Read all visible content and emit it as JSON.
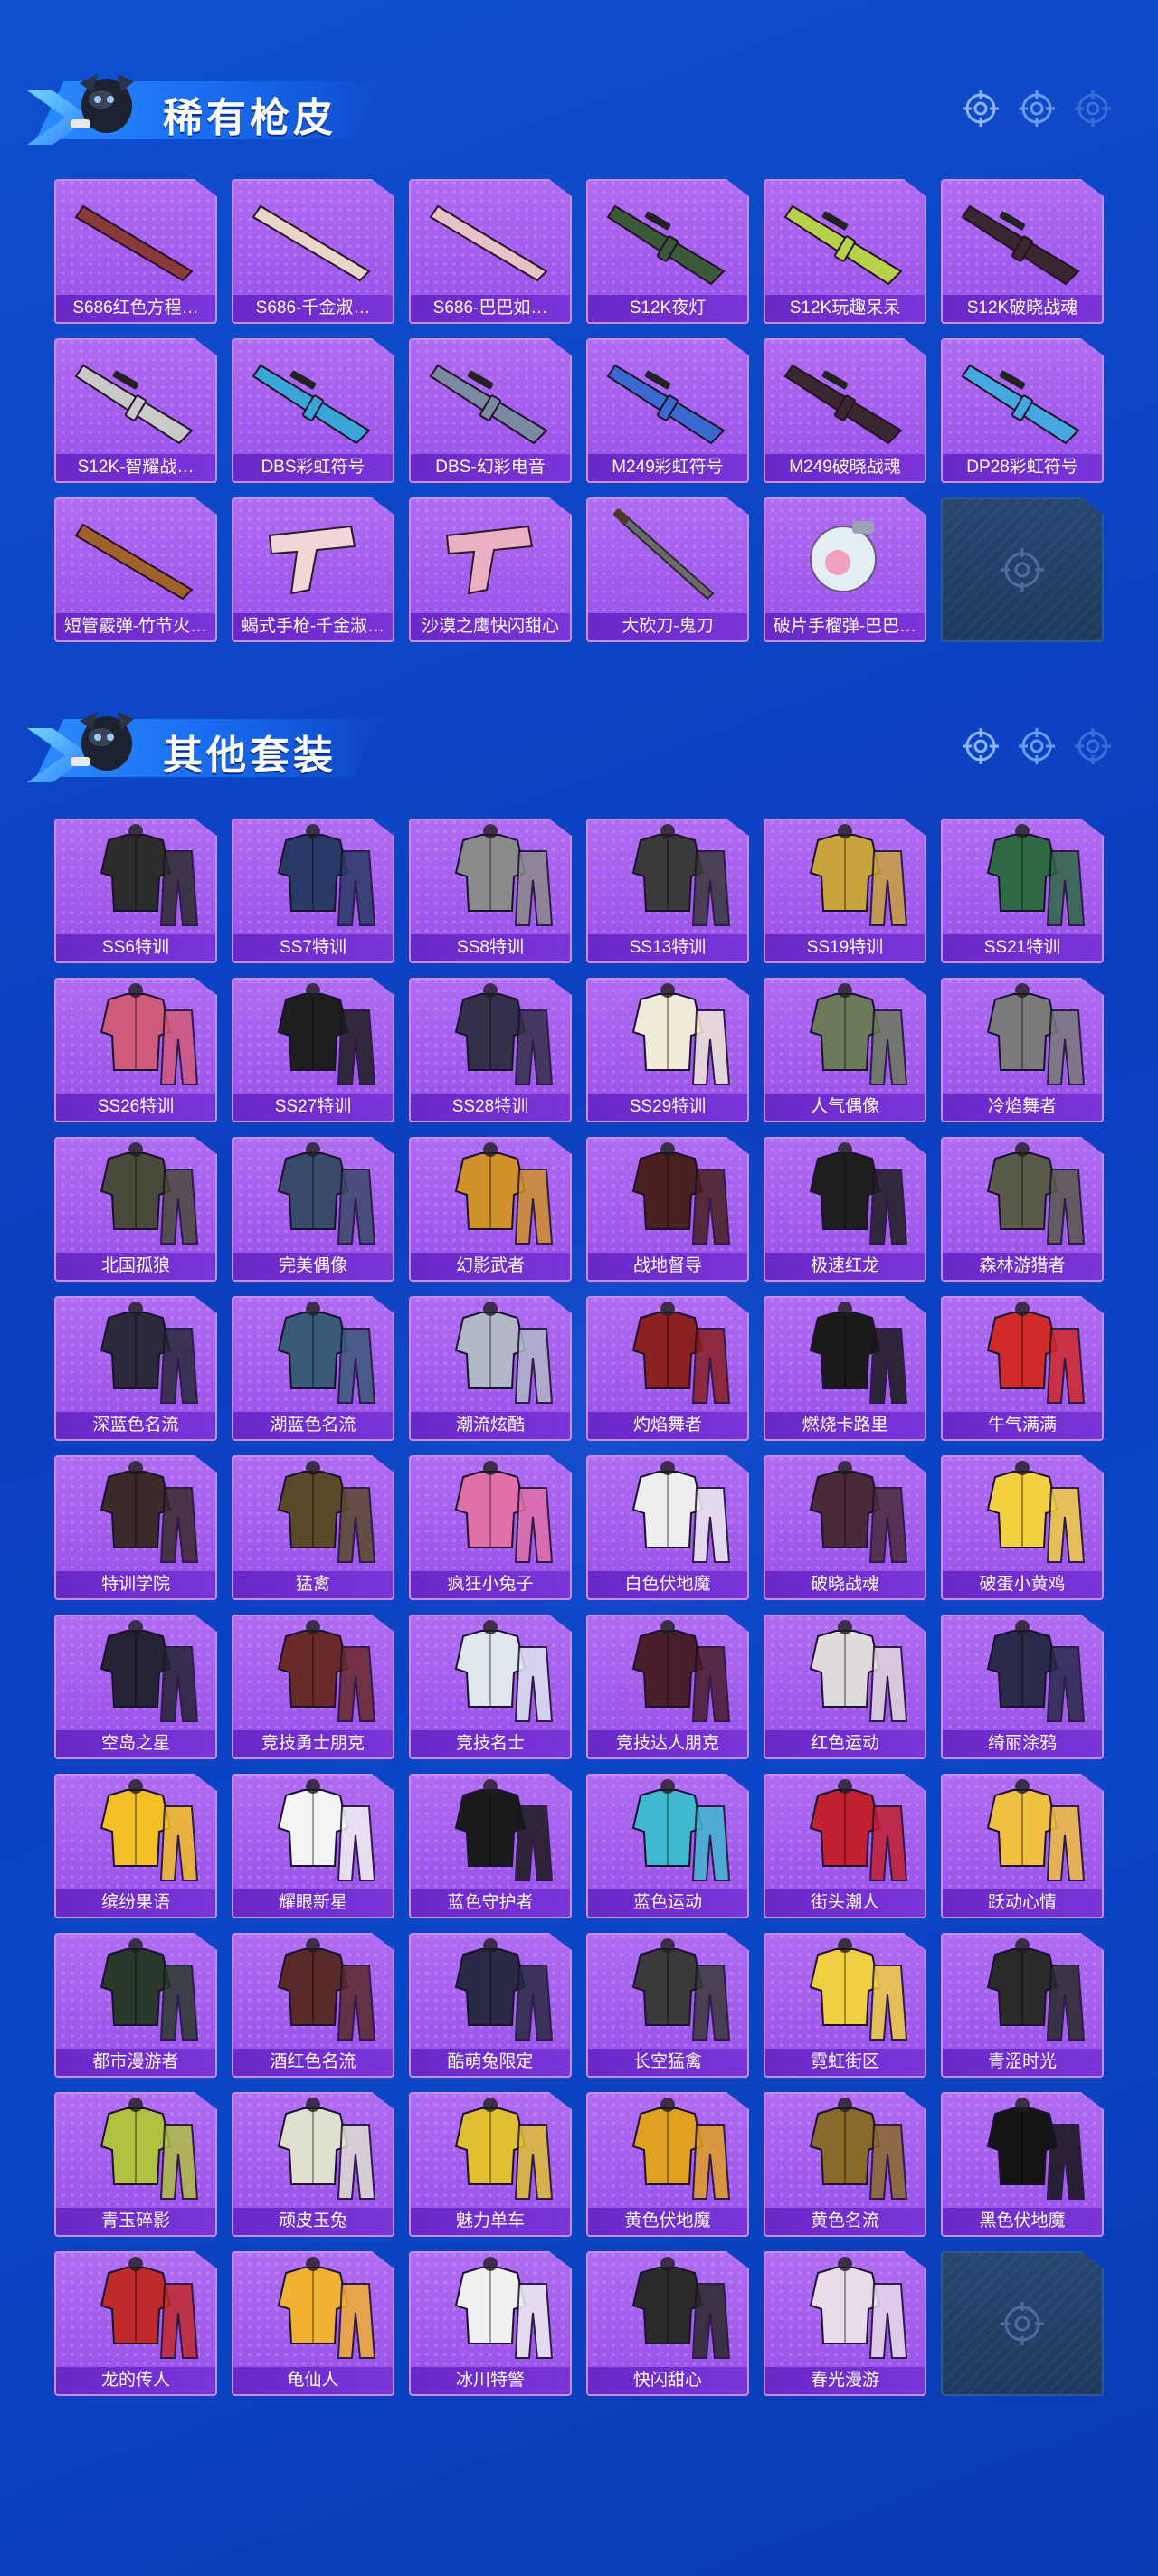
{
  "sections": [
    {
      "title": "稀有枪皮",
      "items": [
        {
          "label": "S686红色方程…",
          "kind": "shotgun",
          "color": "#8a3a3a"
        },
        {
          "label": "S686-千金淑…",
          "kind": "shotgun",
          "color": "#e9d6c6"
        },
        {
          "label": "S686-巴巴如…",
          "kind": "shotgun",
          "color": "#e7c2c6"
        },
        {
          "label": "S12K夜灯",
          "kind": "rifle",
          "color": "#3a5a3a"
        },
        {
          "label": "S12K玩趣呆呆",
          "kind": "rifle",
          "color": "#b6d24a"
        },
        {
          "label": "S12K破晓战魂",
          "kind": "rifle",
          "color": "#3a2830"
        },
        {
          "label": "S12K-智耀战…",
          "kind": "rifle",
          "color": "#c9c9c9"
        },
        {
          "label": "DBS彩虹符号",
          "kind": "bullpup",
          "color": "#3aa6d8"
        },
        {
          "label": "DBS-幻彩电音",
          "kind": "bullpup",
          "color": "#7a8aa0"
        },
        {
          "label": "M249彩虹符号",
          "kind": "lmg",
          "color": "#3a6ad0"
        },
        {
          "label": "M249破晓战魂",
          "kind": "lmg",
          "color": "#3a2830"
        },
        {
          "label": "DP28彩虹符号",
          "kind": "lmg",
          "color": "#46a8e0"
        },
        {
          "label": "短管霰弹-竹节火…",
          "kind": "sawed",
          "color": "#a0622a"
        },
        {
          "label": "蝎式手枪-千金淑…",
          "kind": "smg",
          "color": "#f0d6d6"
        },
        {
          "label": "沙漠之鹰快闪甜心",
          "kind": "pistol",
          "color": "#e8b0c0"
        },
        {
          "label": "大砍刀-鬼刀",
          "kind": "blade",
          "color": "#6a6a6a"
        },
        {
          "label": "破片手榴弹-巴巴…",
          "kind": "grenade",
          "color": "#e2eef2"
        },
        {
          "label": "",
          "kind": "empty",
          "color": "#1f3a60"
        }
      ]
    },
    {
      "title": "其他套装",
      "items": [
        {
          "label": "SS6特训",
          "kind": "suit",
          "color": "#2c2c2c"
        },
        {
          "label": "SS7特训",
          "kind": "suit",
          "color": "#2a3a66"
        },
        {
          "label": "SS8特训",
          "kind": "suit",
          "color": "#8a8a8a"
        },
        {
          "label": "SS13特训",
          "kind": "suit",
          "color": "#3a3a3a"
        },
        {
          "label": "SS19特训",
          "kind": "suit",
          "color": "#c8a23a"
        },
        {
          "label": "SS21特训",
          "kind": "suit",
          "color": "#2f6a45"
        },
        {
          "label": "SS26特训",
          "kind": "suit",
          "color": "#d05a7a"
        },
        {
          "label": "SS27特训",
          "kind": "suit",
          "color": "#1e1e1e"
        },
        {
          "label": "SS28特训",
          "kind": "suit",
          "color": "#34304a"
        },
        {
          "label": "SS29特训",
          "kind": "suit",
          "color": "#f0ead8"
        },
        {
          "label": "人气偶像",
          "kind": "suit",
          "color": "#6a7a5a"
        },
        {
          "label": "冷焰舞者",
          "kind": "suit",
          "color": "#7a7a7a"
        },
        {
          "label": "北国孤狼",
          "kind": "suit",
          "color": "#4a4a3a"
        },
        {
          "label": "完美偶像",
          "kind": "suit",
          "color": "#3a4a6a"
        },
        {
          "label": "幻影武者",
          "kind": "suit",
          "color": "#d0902a"
        },
        {
          "label": "战地督导",
          "kind": "suit",
          "color": "#4a2020"
        },
        {
          "label": "极速红龙",
          "kind": "suit",
          "color": "#1e1e1e"
        },
        {
          "label": "森林游猎者",
          "kind": "suit",
          "color": "#5a5a4a"
        },
        {
          "label": "深蓝色名流",
          "kind": "suit",
          "color": "#2a2a3a"
        },
        {
          "label": "湖蓝色名流",
          "kind": "suit",
          "color": "#3a5a7a"
        },
        {
          "label": "潮流炫酷",
          "kind": "suit",
          "color": "#b0b8c8"
        },
        {
          "label": "灼焰舞者",
          "kind": "suit",
          "color": "#8a2020"
        },
        {
          "label": "燃烧卡路里",
          "kind": "suit",
          "color": "#1a1a1a"
        },
        {
          "label": "牛气满满",
          "kind": "suit",
          "color": "#d02a2a"
        },
        {
          "label": "特训学院",
          "kind": "suit",
          "color": "#3a2a2a"
        },
        {
          "label": "猛禽",
          "kind": "suit",
          "color": "#5a4a2a"
        },
        {
          "label": "疯狂小兔子",
          "kind": "suit",
          "color": "#e070a8"
        },
        {
          "label": "白色伏地魔",
          "kind": "suit",
          "color": "#eeeeee"
        },
        {
          "label": "破晓战魂",
          "kind": "suit",
          "color": "#4a2a3a"
        },
        {
          "label": "破蛋小黄鸡",
          "kind": "suit",
          "color": "#f2d040"
        },
        {
          "label": "空岛之星",
          "kind": "suit",
          "color": "#242434"
        },
        {
          "label": "竞技勇士朋克",
          "kind": "suit",
          "color": "#6a2a2a"
        },
        {
          "label": "竞技名士",
          "kind": "suit",
          "color": "#dfe6ee"
        },
        {
          "label": "竞技达人朋克",
          "kind": "suit",
          "color": "#4a1e2a"
        },
        {
          "label": "红色运动",
          "kind": "suit",
          "color": "#e0dada"
        },
        {
          "label": "绮丽涂鸦",
          "kind": "suit",
          "color": "#2a2a4a"
        },
        {
          "label": "缤纷果语",
          "kind": "suit",
          "color": "#f2c024"
        },
        {
          "label": "耀眼新星",
          "kind": "suit",
          "color": "#f4f4f4"
        },
        {
          "label": "蓝色守护者",
          "kind": "suit",
          "color": "#1a1a1a"
        },
        {
          "label": "蓝色运动",
          "kind": "suit",
          "color": "#40b8d0"
        },
        {
          "label": "街头潮人",
          "kind": "suit",
          "color": "#c02030"
        },
        {
          "label": "跃动心情",
          "kind": "suit",
          "color": "#f0c040"
        },
        {
          "label": "都市漫游者",
          "kind": "suit",
          "color": "#2a3a2a"
        },
        {
          "label": "酒红色名流",
          "kind": "suit",
          "color": "#5a2a2a"
        },
        {
          "label": "酷萌兔限定",
          "kind": "suit",
          "color": "#2a2a44"
        },
        {
          "label": "长空猛禽",
          "kind": "suit",
          "color": "#3a3a3a"
        },
        {
          "label": "霓虹街区",
          "kind": "suit",
          "color": "#f0d040"
        },
        {
          "label": "青涩时光",
          "kind": "suit",
          "color": "#2a2a2a"
        },
        {
          "label": "青玉碎影",
          "kind": "suit",
          "color": "#b0c040"
        },
        {
          "label": "顽皮玉兔",
          "kind": "suit",
          "color": "#e0e0d0"
        },
        {
          "label": "魅力单车",
          "kind": "suit",
          "color": "#e0c030"
        },
        {
          "label": "黄色伏地魔",
          "kind": "suit",
          "color": "#e0a020"
        },
        {
          "label": "黄色名流",
          "kind": "suit",
          "color": "#8a6a2a"
        },
        {
          "label": "黑色伏地魔",
          "kind": "suit",
          "color": "#141414"
        },
        {
          "label": "龙的传人",
          "kind": "suit",
          "color": "#c02a2a"
        },
        {
          "label": "龟仙人",
          "kind": "suit",
          "color": "#f2b030"
        },
        {
          "label": "冰川特警",
          "kind": "suit",
          "color": "#f0f0f0"
        },
        {
          "label": "快闪甜心",
          "kind": "suit",
          "color": "#2a2a2a"
        },
        {
          "label": "春光漫游",
          "kind": "suit",
          "color": "#e8dce8"
        },
        {
          "label": "",
          "kind": "empty",
          "color": "#1f3a60"
        }
      ]
    }
  ],
  "colors": {
    "background": "#0b44c4",
    "card_fill": "#a45cee",
    "card_border": "#c98cff",
    "label_bar": "#6e2ccc",
    "empty_card": "#22406a"
  },
  "icons": [
    "crosshair-icon",
    "crosshair-icon",
    "crosshair-icon"
  ]
}
